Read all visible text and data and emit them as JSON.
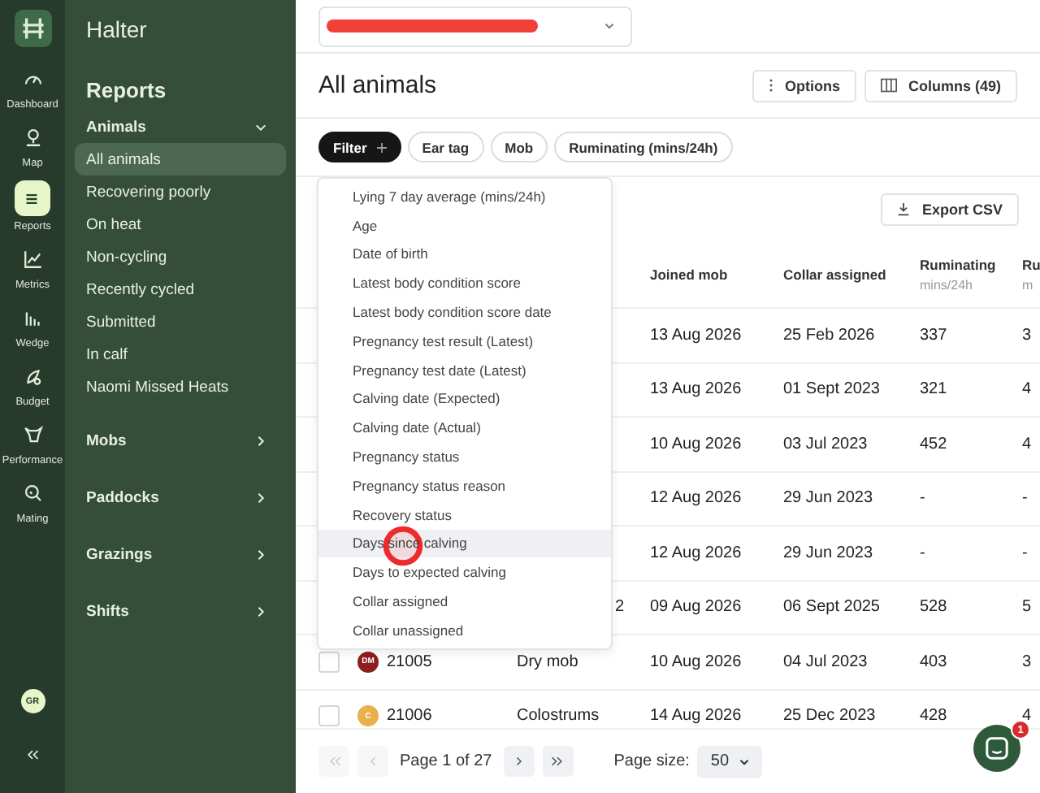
{
  "rail": {
    "items": [
      {
        "label": "Dashboard",
        "selected": false
      },
      {
        "label": "Map",
        "selected": false
      },
      {
        "label": "Reports",
        "selected": true
      },
      {
        "label": "Metrics",
        "selected": false
      },
      {
        "label": "Wedge",
        "selected": false
      },
      {
        "label": "Budget",
        "selected": false
      },
      {
        "label": "Performance",
        "selected": false
      },
      {
        "label": "Mating",
        "selected": false
      }
    ],
    "user_initials": "GR"
  },
  "nav": {
    "brand": "Halter",
    "heading": "Reports",
    "sections": [
      {
        "label": "Animals",
        "expanded": true,
        "items": [
          {
            "label": "All animals",
            "selected": true
          },
          {
            "label": "Recovering poorly",
            "selected": false
          },
          {
            "label": "On heat",
            "selected": false
          },
          {
            "label": "Non-cycling",
            "selected": false
          },
          {
            "label": "Recently cycled",
            "selected": false
          },
          {
            "label": "Submitted",
            "selected": false
          },
          {
            "label": "In calf",
            "selected": false
          },
          {
            "label": "Naomi Missed Heats",
            "selected": false
          }
        ]
      },
      {
        "label": "Mobs",
        "expanded": false
      },
      {
        "label": "Paddocks",
        "expanded": false
      },
      {
        "label": "Grazings",
        "expanded": false
      },
      {
        "label": "Shifts",
        "expanded": false
      }
    ]
  },
  "top_bar": {
    "selector_redacted": true
  },
  "page": {
    "title": "All animals",
    "buttons": [
      {
        "label": "Options",
        "kind": "options"
      },
      {
        "label": "Columns (49)",
        "kind": "columns"
      }
    ]
  },
  "filters": [
    {
      "label": "Filter",
      "kind": "add"
    },
    {
      "label": "Ear tag",
      "kind": "chip"
    },
    {
      "label": "Mob",
      "kind": "chip"
    },
    {
      "label": "Ruminating (mins/24h)",
      "kind": "chip"
    }
  ],
  "export_button": "Export CSV",
  "table": {
    "columns": [
      {
        "label": "Joined mob"
      },
      {
        "label": "Collar assigned"
      },
      {
        "label": "Ruminating",
        "unit": "mins/24h"
      },
      {
        "label": "Ru",
        "unit": "m"
      }
    ],
    "rows": [
      {
        "kind": "behind_menu",
        "joined_mob": "13 Aug 2026",
        "collar_assigned": "25 Feb 2026",
        "ruminating": "337",
        "column_7": "3"
      },
      {
        "kind": "behind_menu",
        "joined_mob": "13 Aug 2026",
        "collar_assigned": "01 Sept 2023",
        "ruminating": "321",
        "column_7": "4"
      },
      {
        "kind": "behind_menu",
        "joined_mob": "10 Aug 2026",
        "collar_assigned": "03 Jul 2023",
        "ruminating": "452",
        "column_7": "4"
      },
      {
        "kind": "behind_menu",
        "joined_mob": "12 Aug 2026",
        "collar_assigned": "29 Jun 2023",
        "ruminating": "-",
        "column_7": "-"
      },
      {
        "kind": "behind_menu",
        "joined_mob": "12 Aug 2026",
        "collar_assigned": "29 Jun 2023",
        "ruminating": "-",
        "column_7": "-"
      },
      {
        "kind": "behind_menu",
        "mob": "2",
        "joined_mob": "09 Aug 2026",
        "collar_assigned": "06 Sept 2025",
        "ruminating": "528",
        "column_7": "5"
      },
      {
        "kind": "full",
        "checked": false,
        "avatar": {
          "initials": "DM",
          "color": "#8c1f1c"
        },
        "ear_tag": "21005",
        "mob": "Dry mob",
        "joined_mob": "10 Aug 2026",
        "collar_assigned": "04 Jul 2023",
        "ruminating": "403",
        "column_7": "3"
      },
      {
        "kind": "full",
        "checked": false,
        "avatar": {
          "initials": "C",
          "color": "#e9b04c"
        },
        "ear_tag": "21006",
        "mob": "Colostrums",
        "joined_mob": "14 Aug 2026",
        "collar_assigned": "25 Dec 2023",
        "ruminating": "428",
        "column_7": "4"
      }
    ]
  },
  "dropdown_menu": {
    "items": [
      {
        "label": "Lying 7 day average (mins/24h)",
        "selected": false
      },
      {
        "label": "Age",
        "selected": false
      },
      {
        "label": "Date of birth",
        "selected": false
      },
      {
        "label": "Latest body condition score",
        "selected": false
      },
      {
        "label": "Latest body condition score date",
        "selected": false
      },
      {
        "label": "Pregnancy test result (Latest)",
        "selected": false
      },
      {
        "label": "Pregnancy test date (Latest)",
        "selected": false
      },
      {
        "label": "Calving date (Expected)",
        "selected": false
      },
      {
        "label": "Calving date (Actual)",
        "selected": false
      },
      {
        "label": "Pregnancy status",
        "selected": false
      },
      {
        "label": "Pregnancy status reason",
        "selected": false
      },
      {
        "label": "Recovery status",
        "selected": false
      },
      {
        "label": "Days since calving",
        "selected": true
      },
      {
        "label": "Days to expected calving",
        "selected": false
      },
      {
        "label": "Collar assigned",
        "selected": false
      },
      {
        "label": "Collar unassigned",
        "selected": false
      }
    ]
  },
  "touch_indicator": true,
  "pagination": {
    "first_disabled": true,
    "prev_disabled": true,
    "page_label": "Page 1 of 27",
    "next_disabled": false,
    "last_disabled": false,
    "page_size_label": "Page size:",
    "page_size": "50"
  },
  "chat": {
    "badge": "1"
  }
}
